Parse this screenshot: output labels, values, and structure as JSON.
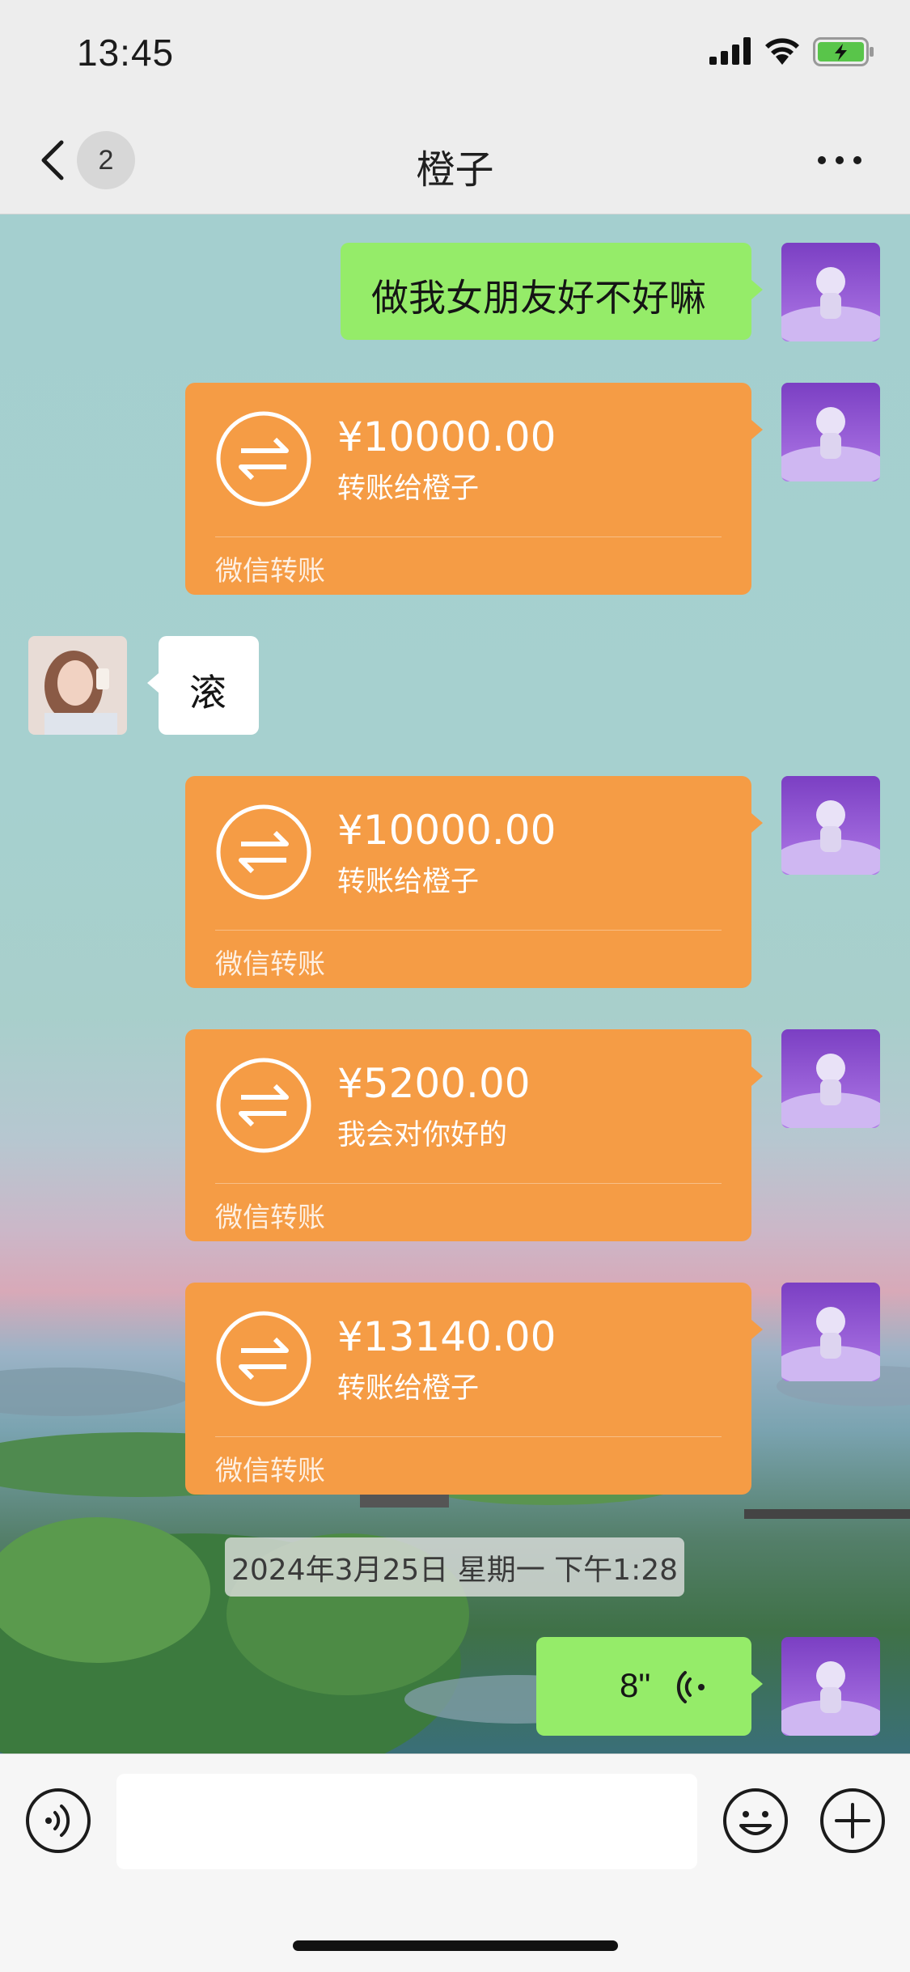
{
  "status_bar": {
    "time": "13:45",
    "icons": [
      "signal-icon",
      "wifi-icon",
      "battery-charging-icon"
    ]
  },
  "nav": {
    "back_icon": "chevron-left-icon",
    "unread_count": "2",
    "title": "橙子",
    "more_icon": "ellipsis-icon"
  },
  "messages": [
    {
      "type": "text",
      "from": "me",
      "text": "做我女朋友好不好嘛"
    },
    {
      "type": "transfer",
      "from": "me",
      "amount": "¥10000.00",
      "note": "转账给橙子",
      "label": "微信转账"
    },
    {
      "type": "text",
      "from": "them",
      "text": "滚"
    },
    {
      "type": "transfer",
      "from": "me",
      "amount": "¥10000.00",
      "note": "转账给橙子",
      "label": "微信转账"
    },
    {
      "type": "transfer",
      "from": "me",
      "amount": "¥5200.00",
      "note": "我会对你好的",
      "label": "微信转账"
    },
    {
      "type": "transfer",
      "from": "me",
      "amount": "¥13140.00",
      "note": "转账给橙子",
      "label": "微信转账"
    },
    {
      "type": "timestamp",
      "text": "2024年3月25日 星期一 下午1:28"
    },
    {
      "type": "voice",
      "from": "me",
      "duration": "8\""
    }
  ],
  "input_bar": {
    "text_value": "",
    "icons": [
      "voice-mode-icon",
      "emoji-icon",
      "plus-icon"
    ]
  },
  "colors": {
    "text_bubble_me": "#95ec69",
    "transfer_bubble": "#f59c45",
    "text_bubble_them": "#ffffff",
    "chat_bg": "#a4cfcf"
  }
}
